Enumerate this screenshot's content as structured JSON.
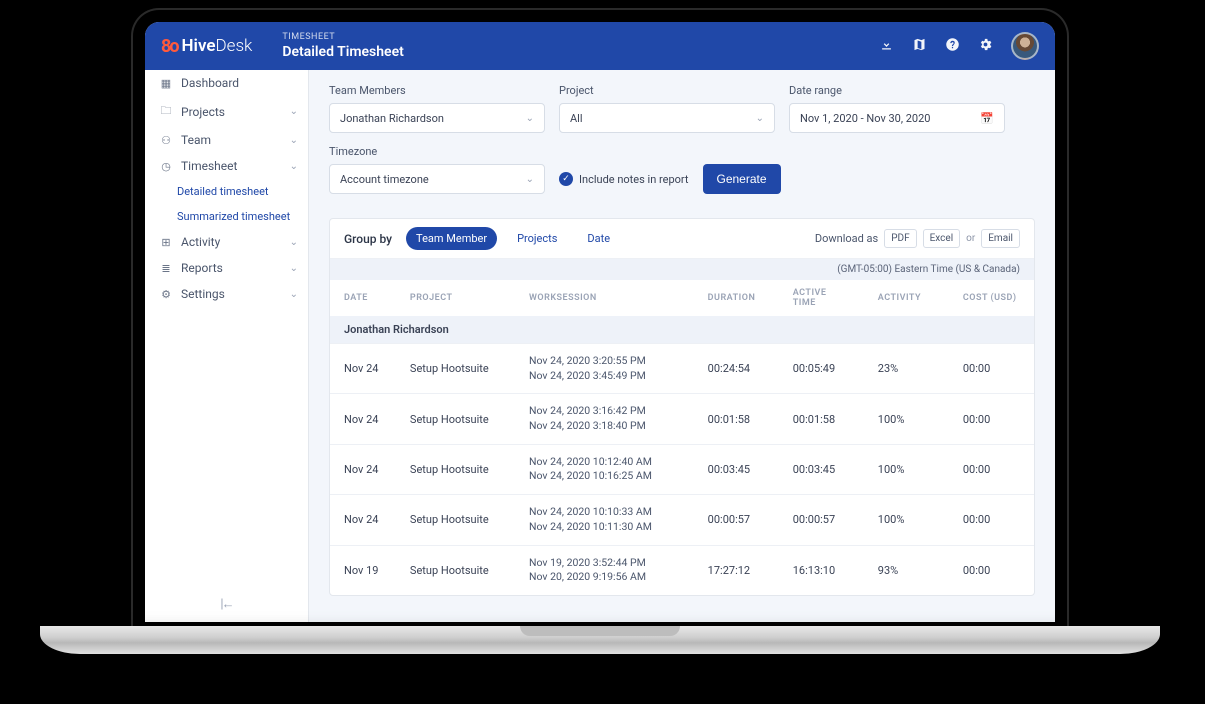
{
  "brand": {
    "icon": "8o",
    "name_bold": "Hive",
    "name_thin": "Desk"
  },
  "header": {
    "breadcrumb": "TIMESHEET",
    "title": "Detailed Timesheet"
  },
  "sidebar": {
    "dashboard": "Dashboard",
    "projects": "Projects",
    "team": "Team",
    "timesheet": "Timesheet",
    "timesheet_sub1": "Detailed timesheet",
    "timesheet_sub2": "Summarized timesheet",
    "activity": "Activity",
    "reports": "Reports",
    "settings": "Settings"
  },
  "filters": {
    "team_label": "Team Members",
    "team_value": "Jonathan Richardson",
    "project_label": "Project",
    "project_value": "All",
    "daterange_label": "Date range",
    "daterange_value": "Nov 1, 2020 - Nov 30, 2020",
    "timezone_label": "Timezone",
    "timezone_value": "Account timezone",
    "include_notes_label": "Include notes in report",
    "generate_label": "Generate"
  },
  "toolbar": {
    "group_by": "Group by",
    "pill_team": "Team Member",
    "pill_projects": "Projects",
    "pill_date": "Date",
    "download_as": "Download as",
    "pdf": "PDF",
    "excel": "Excel",
    "or": "or",
    "email": "Email"
  },
  "tz_display": "(GMT-05:00) Eastern Time (US & Canada)",
  "columns": {
    "date": "DATE",
    "project": "PROJECT",
    "worksession": "WORKSESSION",
    "duration": "DURATION",
    "active_time": "ACTIVE TIME",
    "activity": "ACTIVITY",
    "cost": "COST (USD)"
  },
  "group_name": "Jonathan Richardson",
  "rows": [
    {
      "date": "Nov 24",
      "project": "Setup Hootsuite",
      "ws1": "Nov 24, 2020 3:20:55 PM",
      "ws2": "Nov 24, 2020 3:45:49 PM",
      "duration": "00:24:54",
      "active": "00:05:49",
      "activity": "23%",
      "cost": "00:00"
    },
    {
      "date": "Nov 24",
      "project": "Setup Hootsuite",
      "ws1": "Nov 24, 2020 3:16:42 PM",
      "ws2": "Nov 24, 2020 3:18:40 PM",
      "duration": "00:01:58",
      "active": "00:01:58",
      "activity": "100%",
      "cost": "00:00"
    },
    {
      "date": "Nov 24",
      "project": "Setup Hootsuite",
      "ws1": "Nov 24, 2020 10:12:40 AM",
      "ws2": "Nov 24, 2020 10:16:25 AM",
      "duration": "00:03:45",
      "active": "00:03:45",
      "activity": "100%",
      "cost": "00:00"
    },
    {
      "date": "Nov 24",
      "project": "Setup Hootsuite",
      "ws1": "Nov 24, 2020 10:10:33 AM",
      "ws2": "Nov 24, 2020 10:11:30 AM",
      "duration": "00:00:57",
      "active": "00:00:57",
      "activity": "100%",
      "cost": "00:00"
    },
    {
      "date": "Nov 19",
      "project": "Setup Hootsuite",
      "ws1": "Nov 19, 2020 3:52:44 PM",
      "ws2": "Nov 20, 2020 9:19:56 AM",
      "duration": "17:27:12",
      "active": "16:13:10",
      "activity": "93%",
      "cost": "00:00"
    }
  ]
}
